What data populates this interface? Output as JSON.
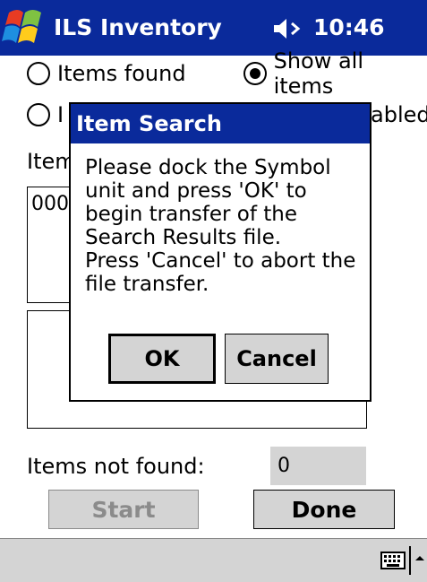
{
  "titlebar": {
    "app_title": "ILS Inventory",
    "time": "10:46",
    "start_icon": "windows-flag-icon",
    "speaker_icon": "speaker-icon"
  },
  "form": {
    "radio_items_found": "Items found",
    "radio_show_all": "Show all items",
    "radio_row2_left_partial": "I",
    "radio_row2_right_partial": "abled",
    "items_label_partial": "Item",
    "list_item_partial": "000",
    "items_not_found_label": "Items not found:",
    "items_not_found_value": "0",
    "start_button": "Start",
    "done_button": "Done"
  },
  "dialog": {
    "title": "Item Search",
    "message_lines": [
      "Please dock the Symbol",
      "unit and press 'OK' to",
      "begin transfer of the",
      "Search Results file.",
      "Press 'Cancel' to abort the",
      "file transfer."
    ],
    "ok_button": "OK",
    "cancel_button": "Cancel"
  },
  "taskbar": {
    "keyboard_icon": "keyboard-icon",
    "sip_arrow_icon": "up-arrow-icon"
  },
  "colors": {
    "titlebar_bg": "#0a2a9b",
    "button_bg": "#d4d4d4"
  }
}
